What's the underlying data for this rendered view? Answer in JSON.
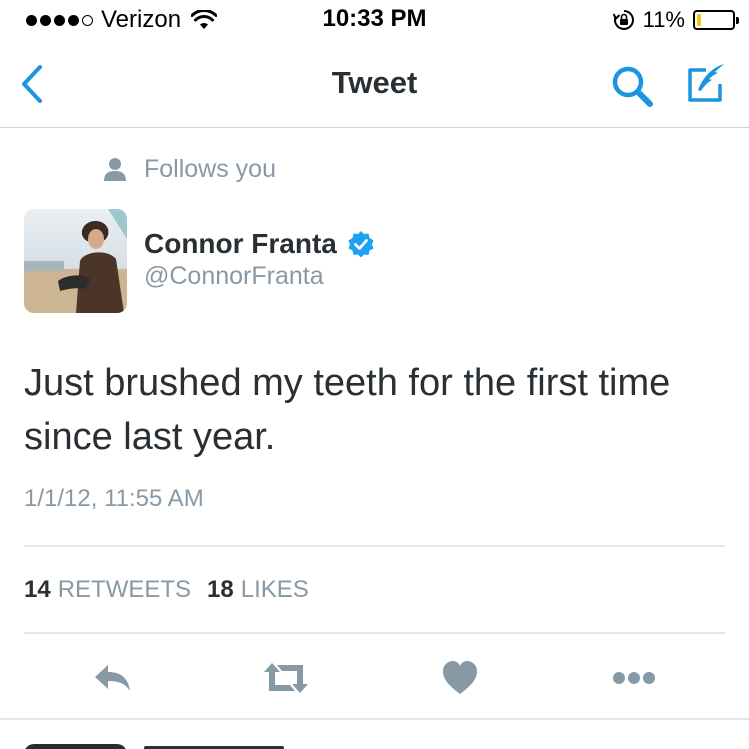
{
  "status_bar": {
    "carrier": "Verizon",
    "time": "10:33 PM",
    "battery_percent": "11%",
    "battery_level": 0.11,
    "signal_bars_filled": 4,
    "signal_bars_total": 5
  },
  "nav": {
    "title": "Tweet",
    "back_icon": "chevron-left-icon",
    "search_icon": "search-icon",
    "compose_icon": "compose-tweet-icon"
  },
  "tweet": {
    "follows_label": "Follows you",
    "author_name": "Connor Franta",
    "author_handle": "@ConnorFranta",
    "verified": true,
    "text": "Just brushed my teeth for the first time since last year.",
    "timestamp": "1/1/12, 11:55 AM",
    "retweets_count": "14",
    "retweets_label": "RETWEETS",
    "likes_count": "18",
    "likes_label": "LIKES"
  },
  "actions": [
    "reply-icon",
    "retweet-icon",
    "heart-icon",
    "more-icon"
  ],
  "colors": {
    "accent": "#1b95e0",
    "text_primary": "#292f33",
    "text_secondary": "#8899a6",
    "action_icon": "#8899a6",
    "divider": "#e1e8ed",
    "battery_low": "#f5c315"
  }
}
